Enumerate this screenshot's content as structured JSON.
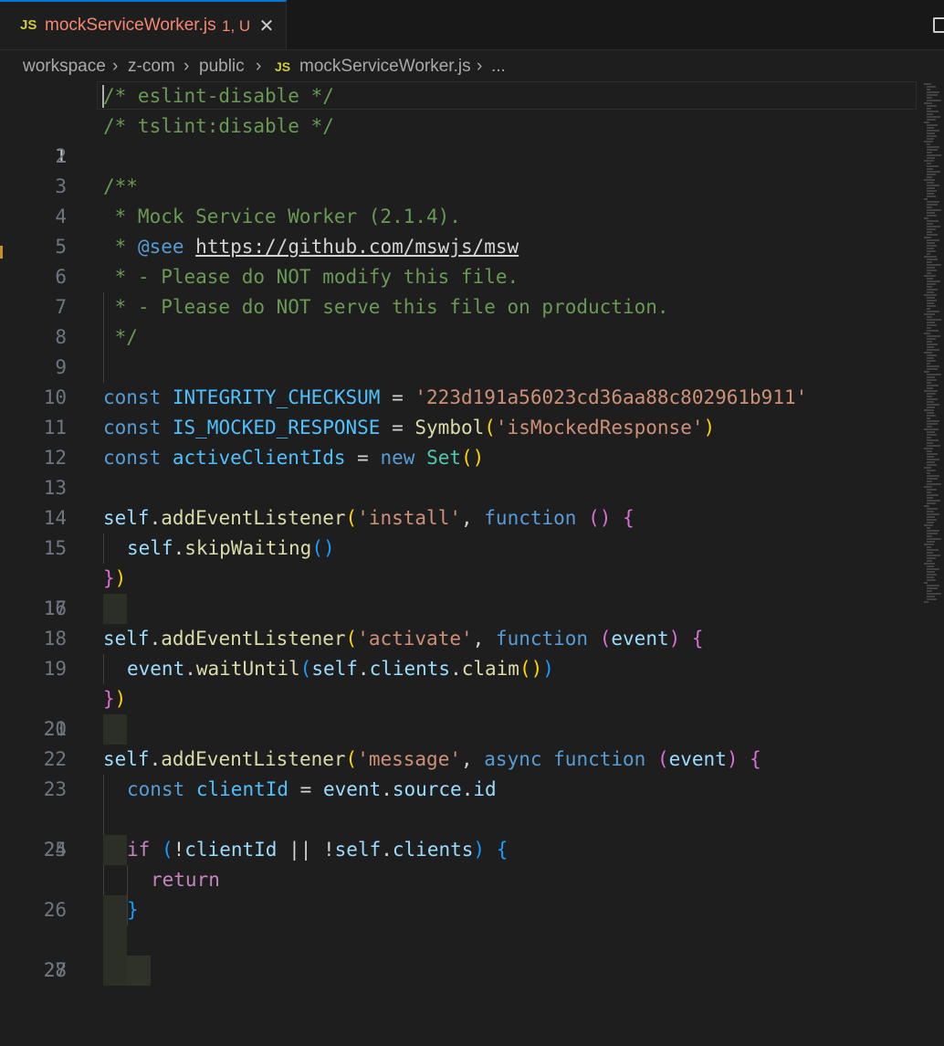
{
  "tab": {
    "badge": "JS",
    "filename": "mockServiceWorker.js",
    "status": "1, U",
    "close": "✕"
  },
  "breadcrumb": {
    "items": [
      "workspace",
      "z-com",
      "public"
    ],
    "file_badge": "JS",
    "file": "mockServiceWorker.js",
    "more": "...",
    "sep": "›"
  },
  "editor": {
    "line_numbers": [
      "1",
      "2",
      "3",
      "4",
      "5",
      "6",
      "7",
      "8",
      "9",
      "10",
      "11",
      "12",
      "13",
      "14",
      "15",
      "16",
      "17",
      "18",
      "19",
      "20",
      "21",
      "22",
      "23",
      "24",
      "25",
      "26",
      "27",
      "28"
    ],
    "active_line": "1",
    "tokens": {
      "l1": "/* eslint-disable */",
      "l2": "/* tslint:disable */",
      "l4": "/**",
      "l5": " * Mock Service Worker (2.1.4).",
      "l6_star": " * ",
      "l6_tag": "@see",
      "l6_sp": " ",
      "l6_link": "https://github.com/mswjs/msw",
      "l7": " * - Please do NOT modify this file.",
      "l8": " * - Please do NOT serve this file on production.",
      "l9": " */",
      "const": "const",
      "l11_name": "INTEGRITY_CHECKSUM",
      "eq": " = ",
      "l11_str": "'223d191a56023cd36aa88c802961b911'",
      "l12_name": "IS_MOCKED_RESPONSE",
      "l12_fn": "Symbol",
      "l12_str": "'isMockedResponse'",
      "l13_name": "activeClientIds",
      "new": "new",
      "l13_cls": "Set",
      "self": "self",
      "dot": ".",
      "addEventListener": "addEventListener",
      "install": "'install'",
      "comma": ", ",
      "function": "function",
      "skipWaiting": "skipWaiting",
      "activate": "'activate'",
      "event": "event",
      "waitUntil": "waitUntil",
      "clients": "clients",
      "claim": "claim",
      "message": "'message'",
      "async": "async",
      "clientId": "clientId",
      "source": "source",
      "id": "id",
      "if": "if",
      "or": " || ",
      "return": "return",
      "open_paren": "(",
      "close_paren": ")",
      "open_brace": "{",
      "close_brace": "}",
      "bang": "!"
    }
  },
  "colors": {
    "tab_accent": "#0078d4",
    "modified_file": "#f48771",
    "js_badge": "#cbcb41",
    "comment": "#6a9955",
    "keyword": "#569cd6",
    "string": "#ce9178",
    "function": "#dcdcaa",
    "variable": "#9cdcfe",
    "constant": "#4fc1ff",
    "class": "#4ec9b0"
  }
}
